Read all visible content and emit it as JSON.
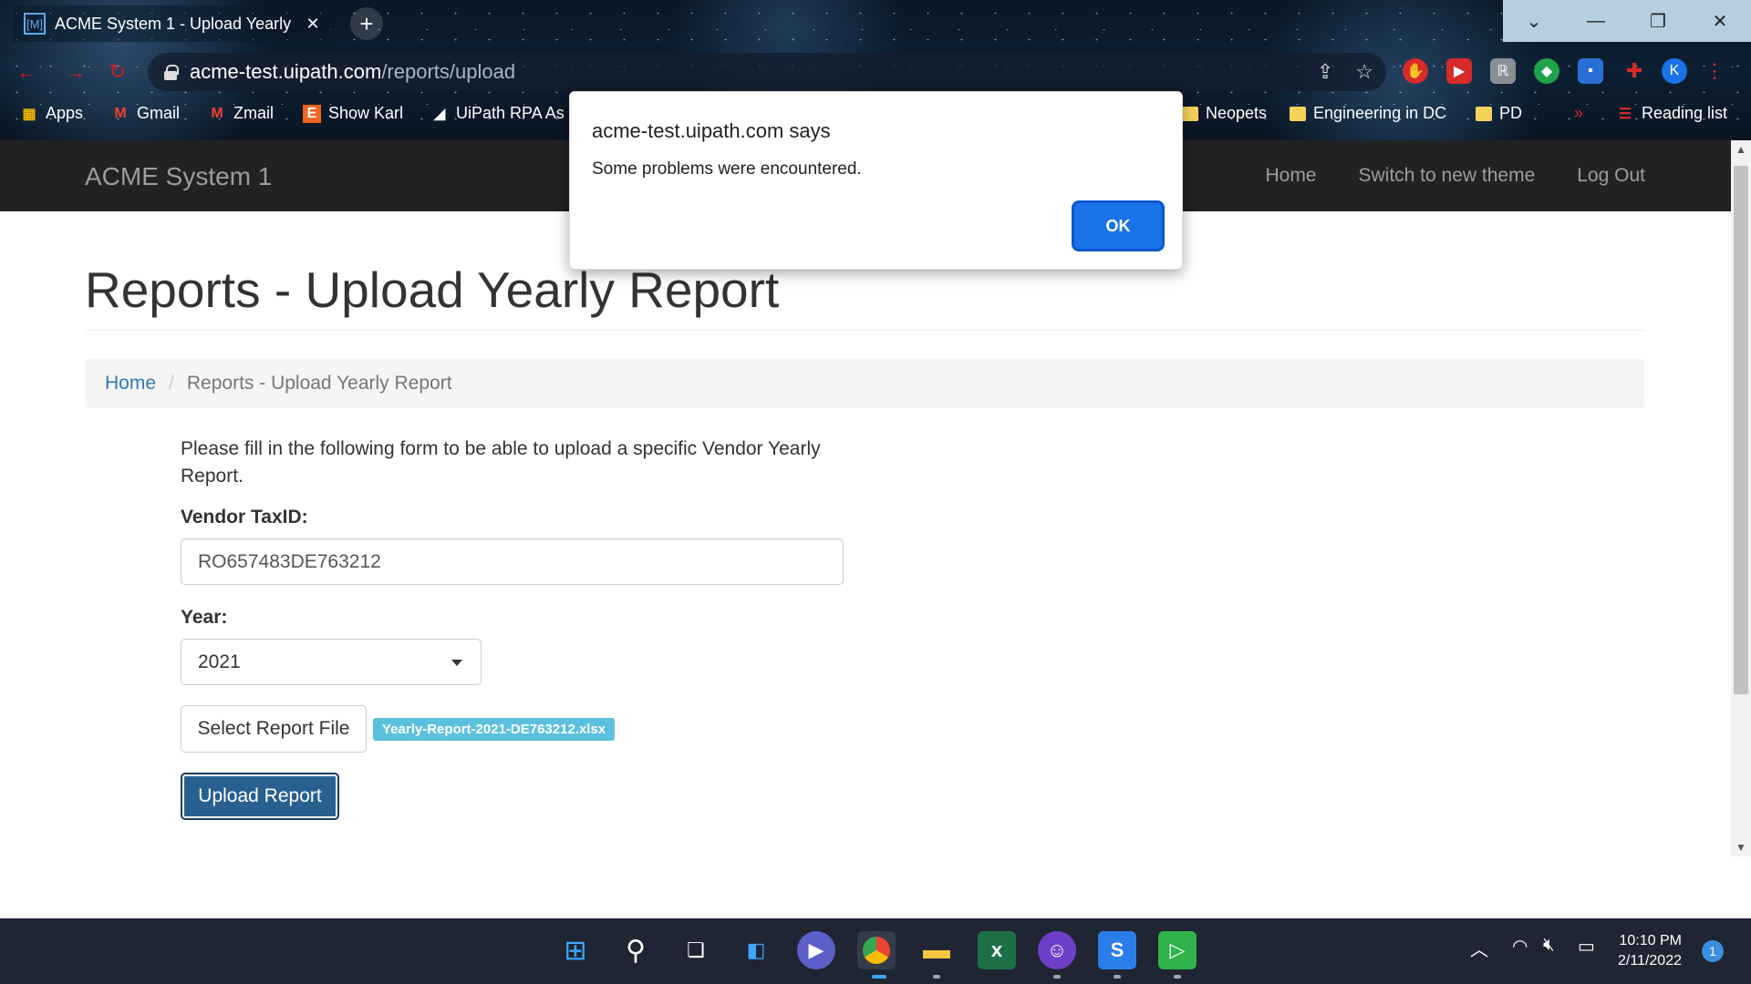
{
  "browser": {
    "tab_title": "ACME System 1 - Upload Yearly",
    "tab_favicon": "[M]",
    "url_host": "acme-test.uipath.com",
    "url_path": "/reports/upload",
    "profile_initial": "K"
  },
  "bookmarks": [
    {
      "label": "Apps",
      "icon": "apps-grid-icon"
    },
    {
      "label": "Gmail",
      "icon": "gmail-icon"
    },
    {
      "label": "Zmail",
      "icon": "gmail-icon"
    },
    {
      "label": "Show Karl",
      "icon": "etsy-icon"
    },
    {
      "label": "UiPath RPA As",
      "icon": "uipath-icon"
    },
    {
      "label": "Neopets",
      "icon": "folder-icon"
    },
    {
      "label": "Engineering in DC",
      "icon": "folder-icon"
    },
    {
      "label": "PD",
      "icon": "folder-icon"
    },
    {
      "label": "»",
      "icon": "more-icon"
    },
    {
      "label": "Reading list",
      "icon": "reading-list-icon"
    }
  ],
  "app": {
    "brand": "ACME System 1",
    "nav": [
      "Home",
      "Switch to new theme",
      "Log Out"
    ]
  },
  "page": {
    "title": "Reports - Upload Yearly Report",
    "breadcrumb_home": "Home",
    "breadcrumb_current": "Reports - Upload Yearly Report",
    "intro": "Please fill in the following form to be able to upload a specific Vendor Yearly Report.",
    "vendor_label": "Vendor TaxID:",
    "vendor_value": "RO657483DE763212",
    "year_label": "Year:",
    "year_value": "2021",
    "select_file_label": "Select Report File",
    "file_name": "Yearly-Report-2021-DE763212.xlsx",
    "upload_label": "Upload Report"
  },
  "dialog": {
    "title": "acme-test.uipath.com says",
    "message": "Some problems were encountered.",
    "ok_label": "OK"
  },
  "taskbar": {
    "time": "10:10 PM",
    "date": "2/11/2022",
    "notifications": "1"
  },
  "colors": {
    "navbar": "#222222",
    "link": "#337ab7",
    "primary_button": "#286090",
    "file_badge": "#5bc0de",
    "dialog_ok": "#1a73e8"
  }
}
